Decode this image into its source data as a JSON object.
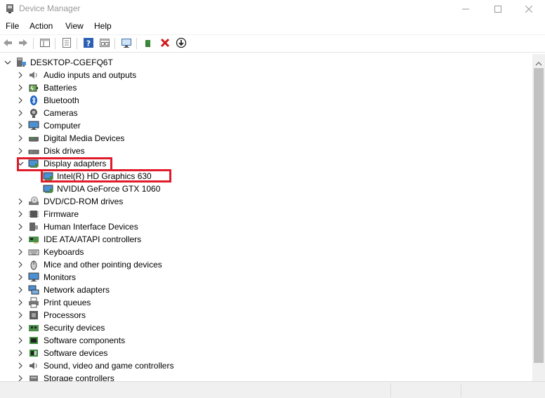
{
  "window": {
    "title": "Device Manager",
    "controls": {
      "minimize": "—",
      "maximize": "☐",
      "close": "✕"
    }
  },
  "menu": [
    "File",
    "Action",
    "View",
    "Help"
  ],
  "tree": {
    "root": "DESKTOP-CGEFQ6T",
    "categories": [
      {
        "label": "Audio inputs and outputs",
        "icon": "speaker-icon"
      },
      {
        "label": "Batteries",
        "icon": "battery-icon"
      },
      {
        "label": "Bluetooth",
        "icon": "bluetooth-icon"
      },
      {
        "label": "Cameras",
        "icon": "camera-icon"
      },
      {
        "label": "Computer",
        "icon": "computer-icon"
      },
      {
        "label": "Digital Media Devices",
        "icon": "media-device-icon"
      },
      {
        "label": "Disk drives",
        "icon": "disk-drive-icon"
      },
      {
        "label": "Display adapters",
        "icon": "display-adapter-icon",
        "expanded": true,
        "children": [
          {
            "label": "Intel(R) HD Graphics 630",
            "icon": "display-adapter-icon"
          },
          {
            "label": "NVIDIA GeForce GTX 1060",
            "icon": "display-adapter-icon"
          }
        ]
      },
      {
        "label": "DVD/CD-ROM drives",
        "icon": "dvd-drive-icon"
      },
      {
        "label": "Firmware",
        "icon": "firmware-icon"
      },
      {
        "label": "Human Interface Devices",
        "icon": "hid-icon"
      },
      {
        "label": "IDE ATA/ATAPI controllers",
        "icon": "ide-controller-icon"
      },
      {
        "label": "Keyboards",
        "icon": "keyboard-icon"
      },
      {
        "label": "Mice and other pointing devices",
        "icon": "mouse-icon"
      },
      {
        "label": "Monitors",
        "icon": "monitor-icon"
      },
      {
        "label": "Network adapters",
        "icon": "network-adapter-icon"
      },
      {
        "label": "Print queues",
        "icon": "printer-icon"
      },
      {
        "label": "Processors",
        "icon": "processor-icon"
      },
      {
        "label": "Security devices",
        "icon": "security-device-icon"
      },
      {
        "label": "Software components",
        "icon": "software-component-icon"
      },
      {
        "label": "Software devices",
        "icon": "software-device-icon"
      },
      {
        "label": "Sound, video and game controllers",
        "icon": "sound-controller-icon"
      },
      {
        "label": "Storage controllers",
        "icon": "storage-controller-icon"
      }
    ]
  },
  "colors": {
    "highlight": "#e11b2a",
    "accent": "#1a73c7"
  }
}
